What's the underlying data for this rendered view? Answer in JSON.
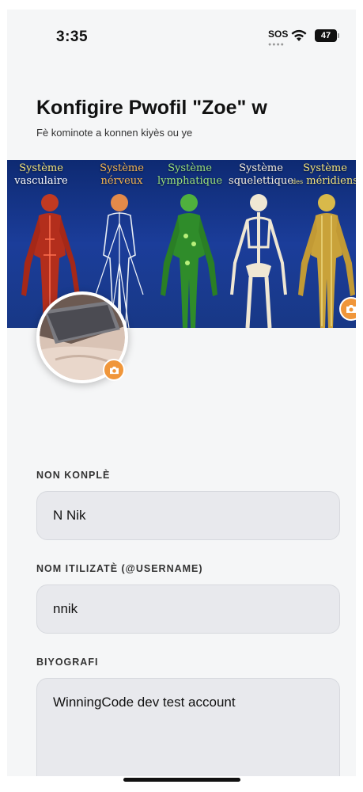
{
  "status_bar": {
    "time": "3:35",
    "sos": "SOS",
    "battery": "47"
  },
  "header": {
    "title": "Konfigire Pwofil \"Zoe\" w",
    "subtitle": "Fè kominote a konnen kiyès ou ye"
  },
  "banner": {
    "labels": [
      {
        "line1": "Système",
        "line2": "vasculaire"
      },
      {
        "line1": "Système",
        "line2": "nérveux"
      },
      {
        "line1": "Système",
        "line2": "lymphatique"
      },
      {
        "line1": "Système",
        "line2": "squelettique"
      },
      {
        "line1": "Système",
        "line2_small": "des",
        "line2": "méridiens"
      }
    ],
    "camera_icon": "camera-icon"
  },
  "avatar": {
    "camera_icon": "camera-icon"
  },
  "form": {
    "full_name": {
      "label": "NON KONPLÈ",
      "value": "N Nik"
    },
    "username": {
      "label": "NOM ITILIZATÈ (@USERNAME)",
      "value": "nnik"
    },
    "bio": {
      "label": "BIYOGRAFI",
      "value": "WinningCode dev test account"
    }
  },
  "colors": {
    "accent": "#f0963a",
    "background": "#f5f6f7",
    "field_bg": "#e8e9ed",
    "banner_bg": "#1b3d9a"
  }
}
